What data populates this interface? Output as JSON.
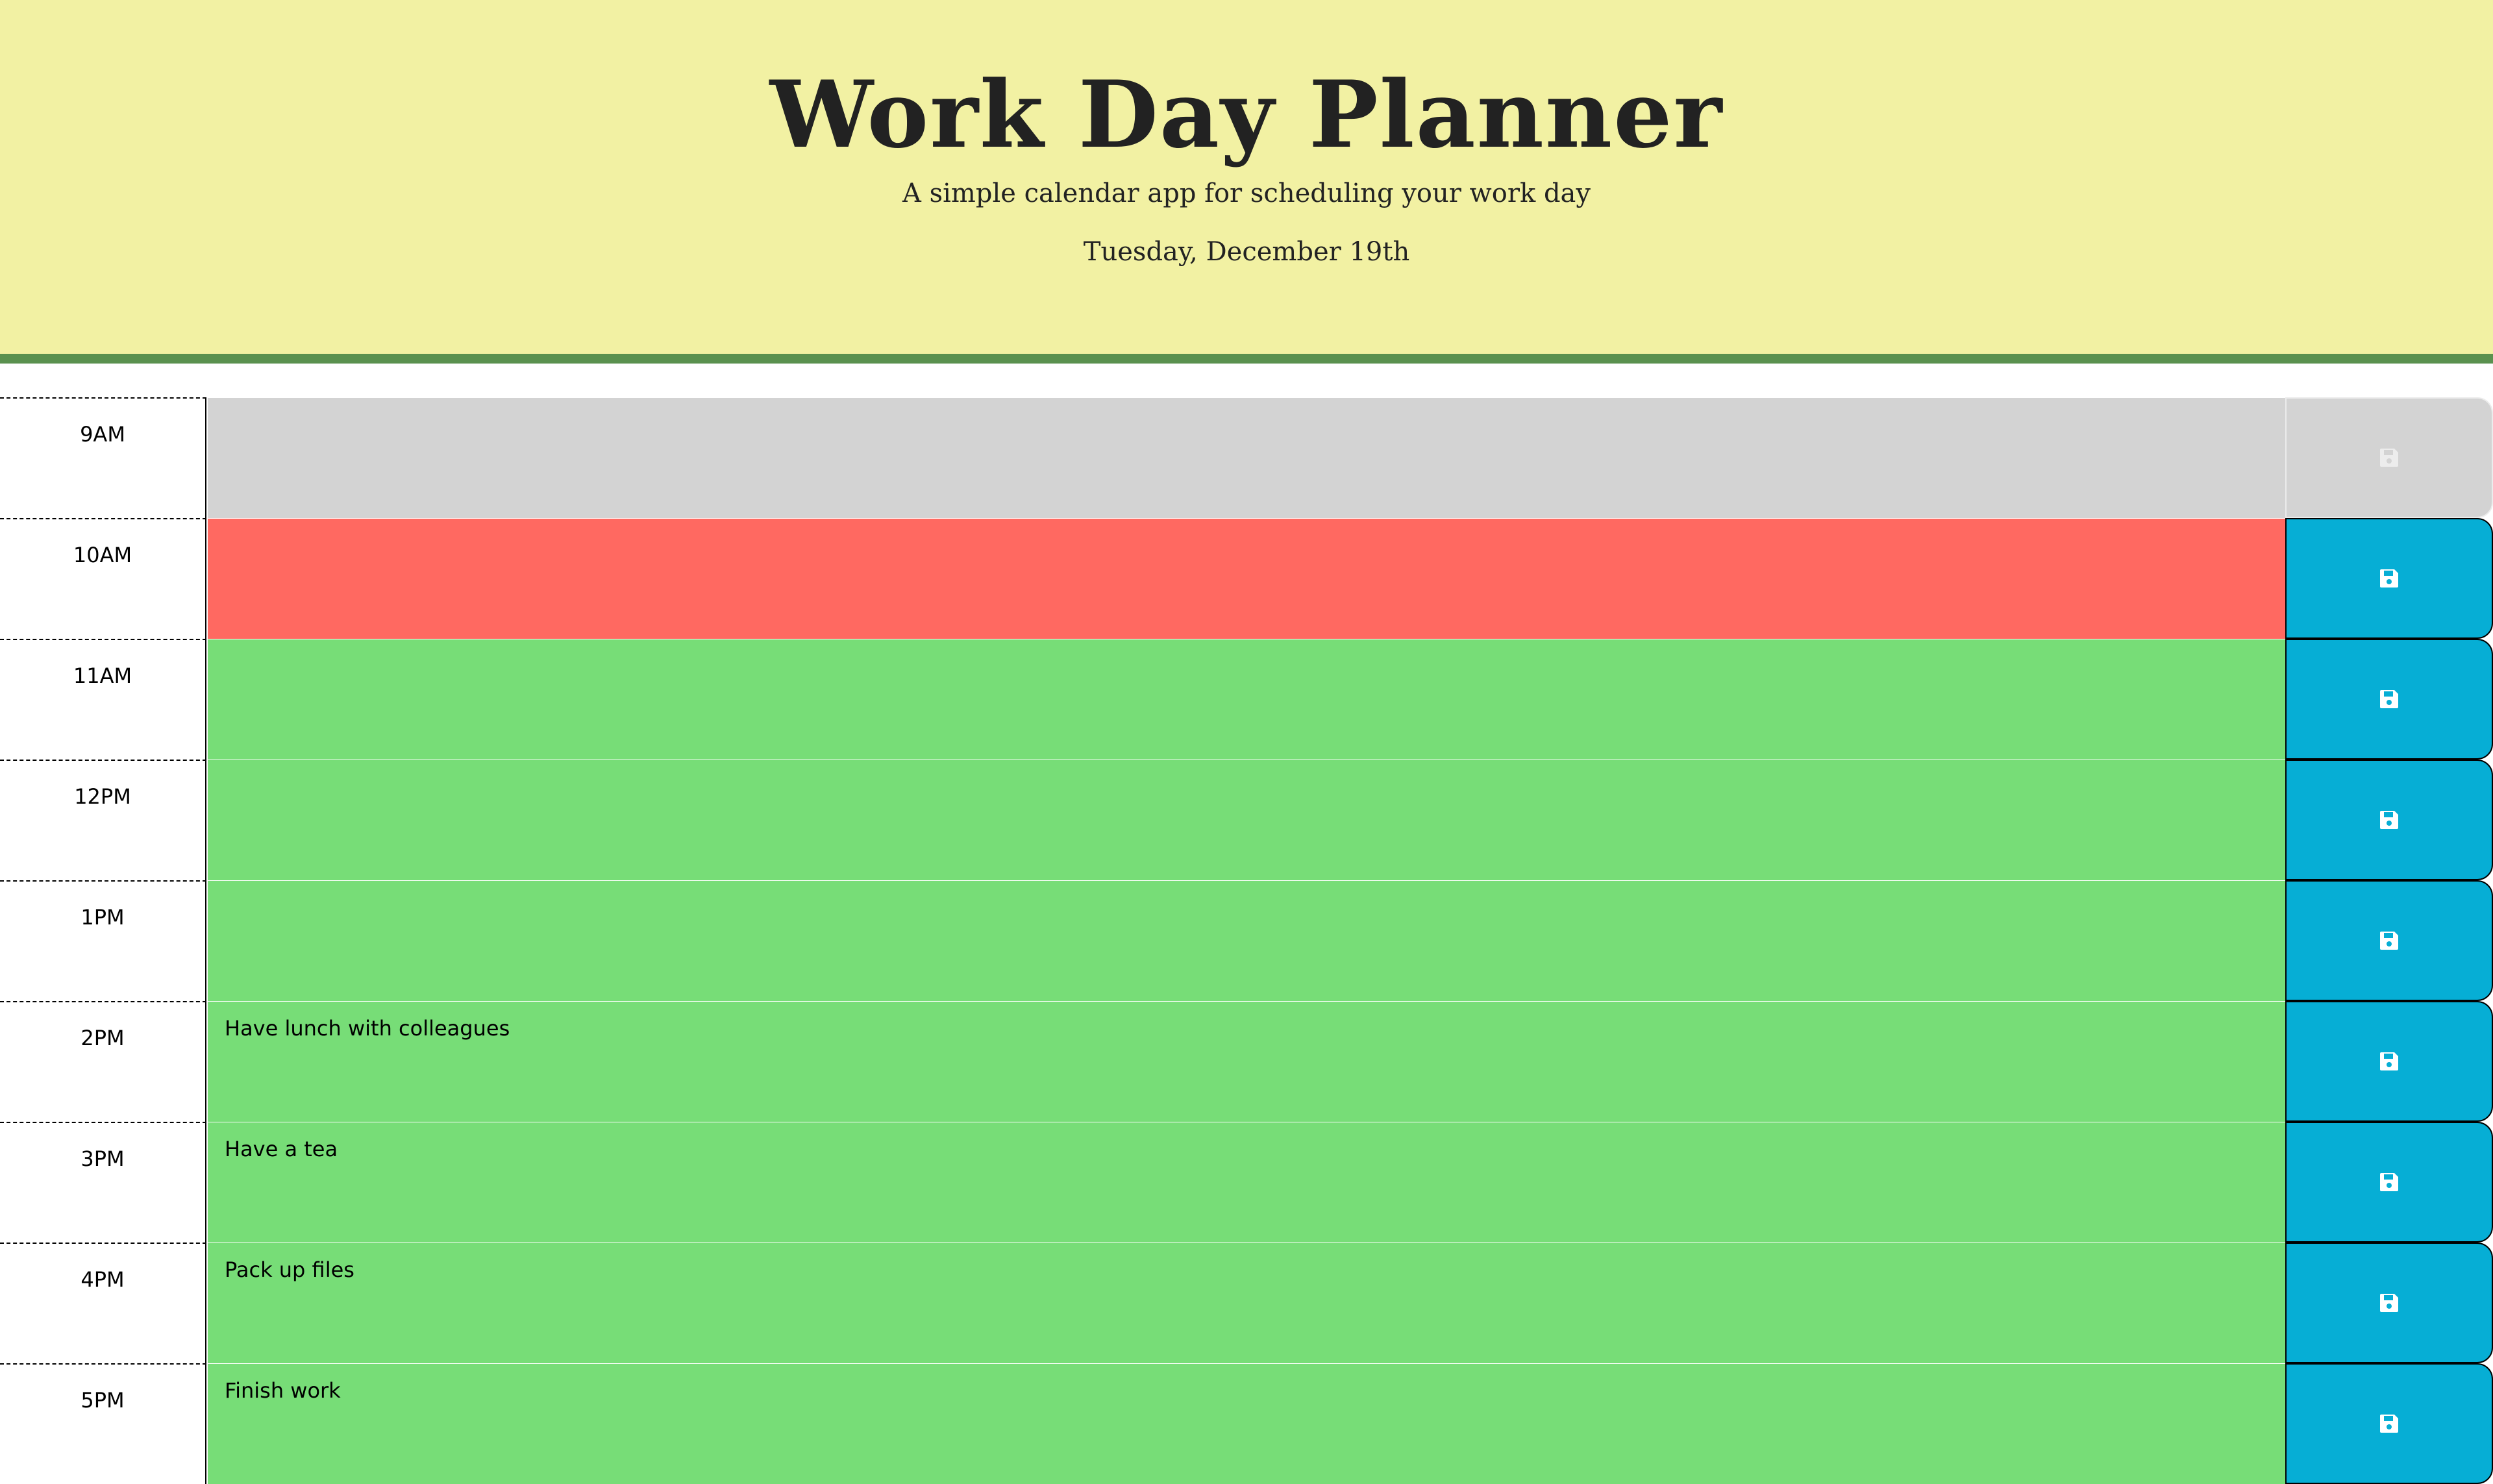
{
  "header": {
    "title": "Work Day Planner",
    "subtitle": "A simple calendar app for scheduling your work day",
    "current_day": "Tuesday, December 19th"
  },
  "colors": {
    "header_bg": "#f2f1a3",
    "header_border": "#5a914f",
    "past": "#d3d3d3",
    "present": "#ff6961",
    "future": "#77dd77",
    "save_button": "#06aed5"
  },
  "time_blocks": [
    {
      "hour": "9AM",
      "text": "",
      "status": "past",
      "save_icon": "floppy-disk-icon"
    },
    {
      "hour": "10AM",
      "text": "",
      "status": "present",
      "save_icon": "floppy-disk-icon"
    },
    {
      "hour": "11AM",
      "text": "",
      "status": "future",
      "save_icon": "floppy-disk-icon"
    },
    {
      "hour": "12PM",
      "text": "",
      "status": "future",
      "save_icon": "floppy-disk-icon"
    },
    {
      "hour": "1PM",
      "text": "",
      "status": "future",
      "save_icon": "floppy-disk-icon"
    },
    {
      "hour": "2PM",
      "text": "Have lunch with colleagues",
      "status": "future",
      "save_icon": "floppy-disk-icon"
    },
    {
      "hour": "3PM",
      "text": "Have a tea",
      "status": "future",
      "save_icon": "floppy-disk-icon"
    },
    {
      "hour": "4PM",
      "text": "Pack up files",
      "status": "future",
      "save_icon": "floppy-disk-icon"
    },
    {
      "hour": "5PM",
      "text": "Finish work",
      "status": "future",
      "save_icon": "floppy-disk-icon"
    }
  ]
}
